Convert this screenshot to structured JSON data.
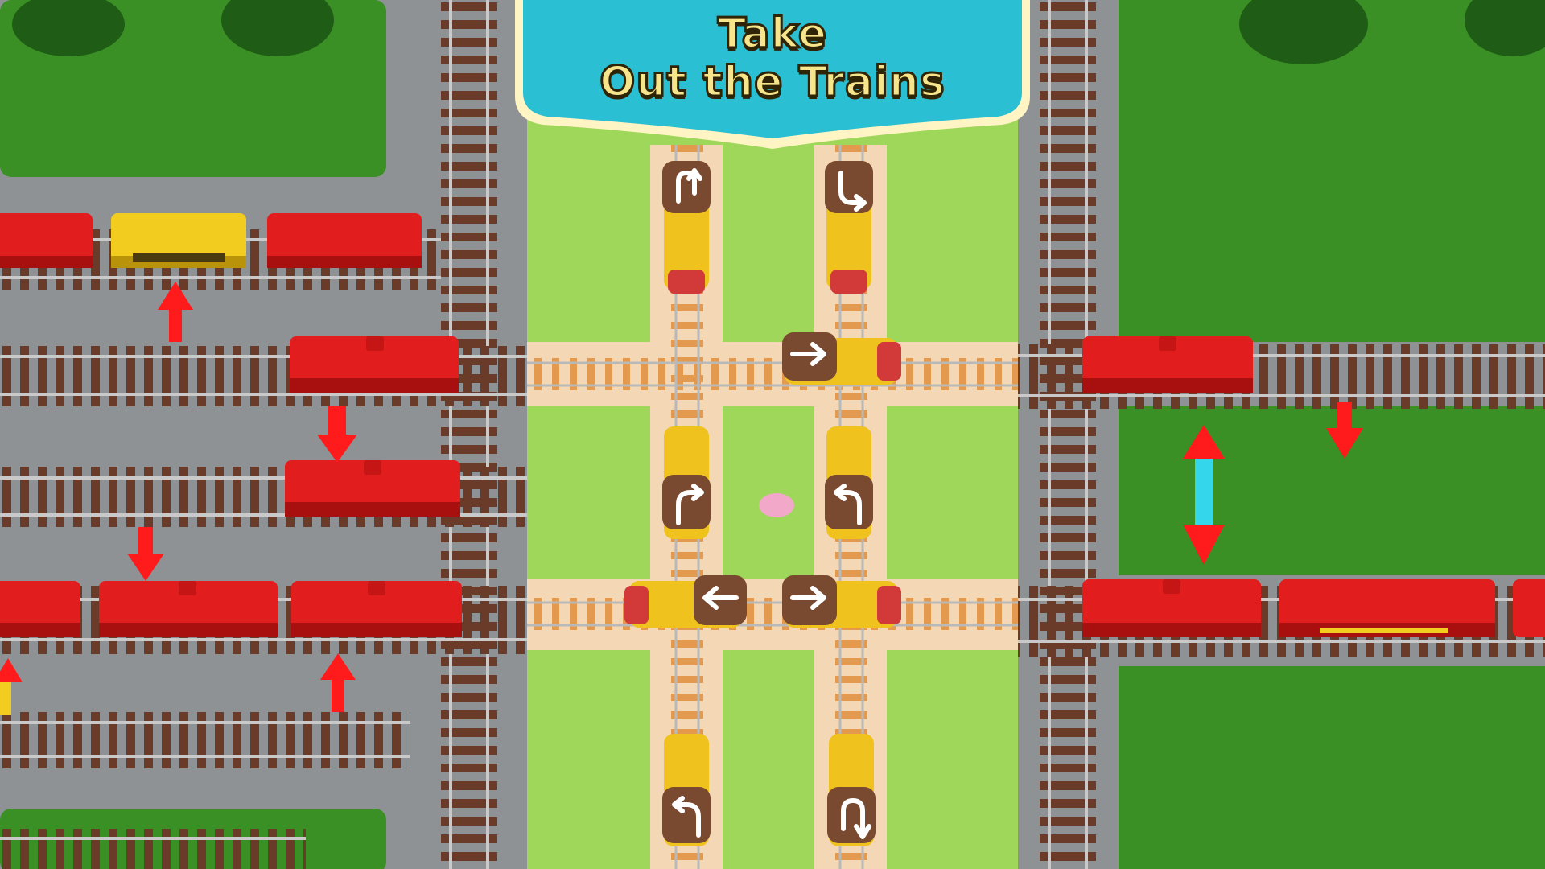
{
  "banner": {
    "title_line1": "Take",
    "title_line2": "Out the Trains"
  },
  "locomotives": [
    {
      "id": "loco-top-left",
      "turn_icon": "u-turn-up-icon"
    },
    {
      "id": "loco-top-right",
      "turn_icon": "u-turn-down-right-icon"
    },
    {
      "id": "loco-row1-right",
      "turn_icon": "arrow-right-icon"
    },
    {
      "id": "loco-mid-left",
      "turn_icon": "turn-right-icon"
    },
    {
      "id": "loco-mid-right",
      "turn_icon": "turn-left-icon"
    },
    {
      "id": "loco-row2-left",
      "turn_icon": "arrow-left-icon"
    },
    {
      "id": "loco-row2-right",
      "turn_icon": "arrow-right-icon"
    },
    {
      "id": "loco-bottom-left",
      "turn_icon": "turn-left-icon"
    },
    {
      "id": "loco-bottom-right",
      "turn_icon": "u-turn-down-icon"
    }
  ],
  "colors": {
    "grass_dark": "#3a8f25",
    "grass_light": "#9fd75a",
    "asphalt": "#8f9294",
    "track_tie": "#6b3b2a",
    "wagon_red": "#e21d1d",
    "wagon_yellow": "#f2cc1f",
    "banner_teal": "#2bbfd4",
    "hint_arrow_red": "#ff1b1b",
    "hint_cyan": "#33d6ea"
  }
}
